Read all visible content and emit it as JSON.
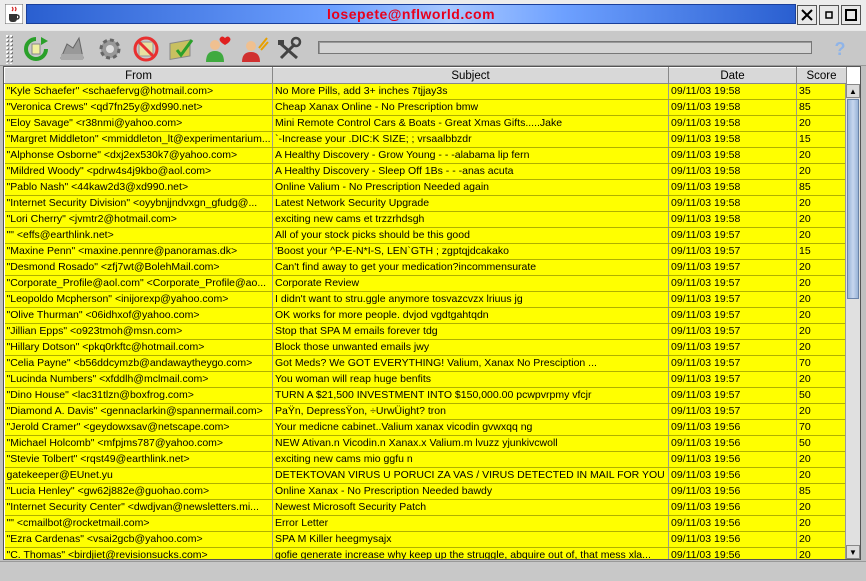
{
  "window": {
    "title": "losepete@nflworld.com"
  },
  "toolbar": {
    "buttons": [
      {
        "name": "refresh-icon",
        "color": "#2aa02a"
      },
      {
        "name": "toggle-icon",
        "color": "#888888"
      },
      {
        "name": "settings-icon",
        "color": "#888888"
      },
      {
        "name": "block-icon",
        "color": "#e83030"
      },
      {
        "name": "approve-icon",
        "color": "#7fbf3f"
      },
      {
        "name": "whitelist-user-icon",
        "color": "#3faa3f"
      },
      {
        "name": "blacklist-user-icon",
        "color": "#d03030"
      },
      {
        "name": "tools-icon",
        "color": "#444444"
      }
    ],
    "help_label": "?"
  },
  "table": {
    "headers": [
      "From",
      "Subject",
      "Date",
      "Score"
    ],
    "rows": [
      [
        "\"Kyle Schaefer\" <schaefervg@hotmail.com>",
        "No More Pills, add 3+ inches     7tjjay3s",
        "09/11/03 19:58",
        "35"
      ],
      [
        "\"Veronica Crews\" <qd7fn25y@xd990.net>",
        "Cheap Xanax Online - No Prescription    bmw",
        "09/11/03 19:58",
        "85"
      ],
      [
        "\"Eloy Savage\" <r38nmi@yahoo.com>",
        "Mini Remote Control Cars & Boats - Great Xmas Gifts.....Jake",
        "09/11/03 19:58",
        "20"
      ],
      [
        "\"Margret Middleton\" <mmiddleton_lt@experimentarium...",
        "`-Increase your .DIC:K SIZE;                  ;    vrsaalbbzdr",
        "09/11/03 19:58",
        "15"
      ],
      [
        "\"Alphonse Osborne\" <dxj2ex530k7@yahoo.com>",
        "A Healthy Discovery - Grow Young - - -alabama lip fern",
        "09/11/03 19:58",
        "20"
      ],
      [
        "\"Mildred Woody\" <pdrw4s4j9kbo@aol.com>",
        "A Healthy Discovery - Sleep Off 1Bs - - -anas acuta",
        "09/11/03 19:58",
        "20"
      ],
      [
        "\"Pablo Nash\" <44kaw2d3@xd990.net>",
        "Online Valium - No Prescription Needed    again",
        "09/11/03 19:58",
        "85"
      ],
      [
        "\"Internet Security Division\" <oyybnjjndvxgn_gfudg@...",
        "Latest Network Security Upgrade",
        "09/11/03 19:58",
        "20"
      ],
      [
        "\"Lori Cherry\" <jvmtr2@hotmail.com>",
        "exciting new cams et trzzrhdsgh",
        "09/11/03 19:58",
        "20"
      ],
      [
        "\"\" <effs@earthlink.net>",
        "All of your stock picks should be this good",
        "09/11/03 19:57",
        "20"
      ],
      [
        "\"Maxine Penn\" <maxine.pennre@panoramas.dk>",
        "'Boost your ^P-E-N*I-S, LEN`GTH                       ;     zgptqjdcakako",
        "09/11/03 19:57",
        "15"
      ],
      [
        "\"Desmond Rosado\" <zfj7wt@BolehMail.com>",
        "Can't find away to get your medication?incommensurate",
        "09/11/03 19:57",
        "20"
      ],
      [
        "\"Corporate_Profile@aol.com\" <Corporate_Profile@ao...",
        "Corporate Review",
        "09/11/03 19:57",
        "20"
      ],
      [
        "\"Leopoldo Mcpherson\" <inijorexp@yahoo.com>",
        "I didn't want to stru.ggle anymore tosvazcvzx lriuus jg",
        "09/11/03 19:57",
        "20"
      ],
      [
        "\"Olive Thurman\" <06idhxof@yahoo.com>",
        "OK works for more people. dvjod vgdtgahtqdn",
        "09/11/03 19:57",
        "20"
      ],
      [
        "\"Jillian Epps\" <o923tmoh@msn.com>",
        "Stop that SPA M emails forever  tdg",
        "09/11/03 19:57",
        "20"
      ],
      [
        "\"Hillary Dotson\" <pkq0rkftc@hotmail.com>",
        "Block those unwanted emails jwy",
        "09/11/03 19:57",
        "20"
      ],
      [
        "\"Celia Payne\" <b56ddcymzb@andawaytheygo.com>",
        "Got Meds? We GOT EVERYTHING! Valium, Xanax No Presciption ...",
        "09/11/03 19:57",
        "70"
      ],
      [
        "\"Lucinda Numbers\" <xfddlh@mclmail.com>",
        "You woman will reap huge benfits",
        "09/11/03 19:57",
        "20"
      ],
      [
        "\"Dino House\" <lac31tlzn@boxfrog.com>",
        "TURN A $21,500 INVESTMENT INTO $150,000.00 pcwpvrpmy vfcjr",
        "09/11/03 19:57",
        "50"
      ],
      [
        "\"Diamond A. Davis\" <gennaclarkin@spannermail.com>",
        "PaŸn, DepressŸon, ÷UrwÜight? tron",
        "09/11/03 19:57",
        "20"
      ],
      [
        "\"Jerold Cramer\" <geydowxsav@netscape.com>",
        "Your medicne cabinet..Valium xanax vicodin gvwxqq ng",
        "09/11/03 19:56",
        "70"
      ],
      [
        "\"Michael Holcomb\" <mfpjms787@yahoo.com>",
        "NEW Ativan.n Vicodin.n Xanax.x Valium.m lvuzz  yjunkivcwoll",
        "09/11/03 19:56",
        "50"
      ],
      [
        "\"Stevie Tolbert\" <rqst49@earthlink.net>",
        "exciting new cams mio ggfu n",
        "09/11/03 19:56",
        "20"
      ],
      [
        "gatekeeper@EUnet.yu",
        "DETEKTOVAN VIRUS U PORUCI ZA VAS / VIRUS DETECTED IN MAIL FOR YOU",
        "09/11/03 19:56",
        "20"
      ],
      [
        "\"Lucia Henley\" <gw62j882e@guohao.com>",
        "Online Xanax - No Prescription Needed    bawdy",
        "09/11/03 19:56",
        "85"
      ],
      [
        "\"Internet Security Center\" <dwdjvan@newsletters.mi...",
        "Newest Microsoft Security Patch",
        "09/11/03 19:56",
        "20"
      ],
      [
        "\"\" <cmailbot@rocketmail.com>",
        "Error Letter",
        "09/11/03 19:56",
        "20"
      ],
      [
        "\"Ezra Cardenas\" <vsai2gcb@yahoo.com>",
        "SPA M Killer heegmysajx",
        "09/11/03 19:56",
        "20"
      ],
      [
        "\"C. Thomas\" <birdjiet@revisionsucks.com>",
        "gofie generate increase why keep up the struggle, abquire out of, that mess xla...",
        "09/11/03 19:56",
        "20"
      ]
    ]
  },
  "colors": {
    "row_bg": "#ffff00",
    "title_text": "#e8001c",
    "title_bar": "#4a7fe0"
  }
}
